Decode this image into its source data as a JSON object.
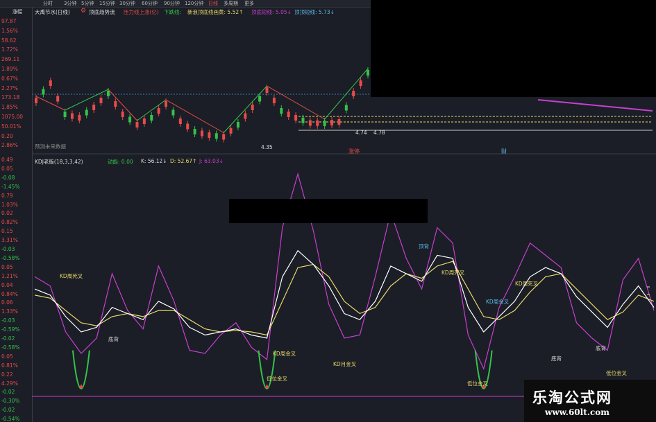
{
  "topbar": {
    "tabs": [
      "分时",
      "3分钟",
      "5分钟",
      "15分钟",
      "30分钟",
      "60分钟",
      "90分钟",
      "120分钟",
      "日线",
      "多周期",
      "更多"
    ],
    "corner": "涨幅"
  },
  "left_axis_top": [
    {
      "t": "97.87",
      "c": "red"
    },
    {
      "t": "1.56%",
      "c": "red"
    },
    {
      "t": "58.62",
      "c": "red"
    },
    {
      "t": "1.72%",
      "c": "red"
    },
    {
      "t": "269.11",
      "c": "red"
    },
    {
      "t": "1.89%",
      "c": "red"
    },
    {
      "t": "0.67%",
      "c": "red"
    },
    {
      "t": "2.27%",
      "c": "red"
    },
    {
      "t": "173.18",
      "c": "red"
    },
    {
      "t": "1.85%",
      "c": "red"
    },
    {
      "t": "1075.00",
      "c": "red"
    },
    {
      "t": "50.01%",
      "c": "red"
    },
    {
      "t": "0.20",
      "c": "red"
    },
    {
      "t": "2.86%",
      "c": "red"
    }
  ],
  "left_axis_bottom": [
    {
      "t": "0.49",
      "c": "red"
    },
    {
      "t": "0.05",
      "c": "red"
    },
    {
      "t": "-0.08",
      "c": "green"
    },
    {
      "t": "-1.45%",
      "c": "green"
    },
    {
      "t": "0.79",
      "c": "red"
    },
    {
      "t": "1.03%",
      "c": "red"
    },
    {
      "t": "0.02",
      "c": "red"
    },
    {
      "t": "0.82%",
      "c": "red"
    },
    {
      "t": "0.15",
      "c": "red"
    },
    {
      "t": "3.31%",
      "c": "red"
    },
    {
      "t": "-0.03",
      "c": "green"
    },
    {
      "t": "-0.58%",
      "c": "green"
    },
    {
      "t": "0.05",
      "c": "red"
    },
    {
      "t": "1.21%",
      "c": "red"
    },
    {
      "t": "0.04",
      "c": "red"
    },
    {
      "t": "0.84%",
      "c": "red"
    },
    {
      "t": "0.06",
      "c": "red"
    },
    {
      "t": "1.33%",
      "c": "red"
    },
    {
      "t": "-0.03",
      "c": "green"
    },
    {
      "t": "-0.59%",
      "c": "green"
    },
    {
      "t": "-0.02",
      "c": "green"
    },
    {
      "t": "-0.58%",
      "c": "green"
    },
    {
      "t": "0.05",
      "c": "red"
    },
    {
      "t": "0.81%",
      "c": "red"
    },
    {
      "t": "0.22",
      "c": "red"
    },
    {
      "t": "4.29%",
      "c": "red"
    },
    {
      "t": "-0.02",
      "c": "green"
    },
    {
      "t": "-0.30%",
      "c": "green"
    },
    {
      "t": "-0.02",
      "c": "green"
    },
    {
      "t": "-0.54%",
      "c": "green"
    }
  ],
  "top_header": {
    "stock": "大禹节水(日线)",
    "indicator": "顶底趋势流",
    "item1": "压力线上涨(亿)",
    "item2": "下跌线:",
    "item3": "新浪顶底线画黄: 5.52↑",
    "item4": "顶底短线: 5.05↓",
    "item5": "顶顶短线: 5.73↓"
  },
  "kdj_header": {
    "name": "KDJ老版(18,3,3,42)",
    "energy": "动能: 0.00",
    "k": "K: 56.12↓",
    "d": "D: 52.67↑",
    "j": "J: 63.03↓"
  },
  "annotations_top": {
    "low1": "4.35",
    "low2": "4.74",
    "low3": "4.78",
    "future": "预测未来数据",
    "badge1": "涨停",
    "badge2": "财"
  },
  "annotations_kdj": [
    "KD周死叉",
    "KD周死叉",
    "KD周死叉",
    "KD周金叉",
    "KD周金叉",
    "KD月金叉",
    "低位金叉",
    "低位金叉",
    "低位金叉",
    "顶背",
    "底背",
    "底背",
    "底背"
  ],
  "watermark": {
    "line1": "乐淘公式网",
    "line2": "www.60lt.com"
  },
  "colors": {
    "bg": "#1b1e26",
    "k": "#ffffff",
    "d": "#e8d86a",
    "j": "#c83fd0",
    "up": "#e84b4b",
    "down": "#35c24b"
  },
  "chart_data": [
    {
      "type": "line",
      "title": "大禹节水(日线)",
      "series": [
        {
          "name": "顶底趋势流",
          "values": [
            5.4,
            5.9,
            5.0,
            4.9,
            5.2,
            5.6,
            5.0,
            4.7,
            4.9,
            5.3,
            4.8,
            4.5,
            4.4,
            4.35,
            4.7,
            5.2,
            5.7,
            5.1,
            4.9,
            4.75,
            4.74,
            4.78,
            5.6,
            6.2
          ]
        }
      ]
    },
    {
      "type": "line",
      "title": "KDJ老版(18,3,3,42)",
      "series": [
        {
          "name": "K",
          "values": [
            70,
            66,
            52,
            42,
            45,
            58,
            54,
            50,
            62,
            57,
            45,
            40,
            42,
            44,
            40,
            38,
            78,
            95,
            86,
            72,
            54,
            50,
            62,
            85,
            80,
            75,
            92,
            90,
            58,
            42,
            52,
            62,
            78,
            84,
            80,
            65,
            55,
            45,
            60,
            72,
            58
          ]
        },
        {
          "name": "D",
          "values": [
            66,
            64,
            56,
            48,
            46,
            52,
            54,
            52,
            56,
            56,
            50,
            44,
            42,
            43,
            42,
            40,
            62,
            84,
            86,
            78,
            62,
            54,
            58,
            72,
            80,
            77,
            85,
            88,
            70,
            52,
            50,
            56,
            68,
            78,
            80,
            70,
            60,
            50,
            55,
            66,
            62
          ]
        },
        {
          "name": "J",
          "values": [
            78,
            72,
            42,
            28,
            38,
            80,
            56,
            44,
            85,
            62,
            30,
            28,
            40,
            48,
            32,
            24,
            110,
            145,
            108,
            60,
            38,
            40,
            78,
            120,
            90,
            70,
            110,
            100,
            40,
            18,
            58,
            78,
            100,
            92,
            84,
            48,
            38,
            30,
            76,
            90,
            56
          ]
        }
      ]
    }
  ]
}
